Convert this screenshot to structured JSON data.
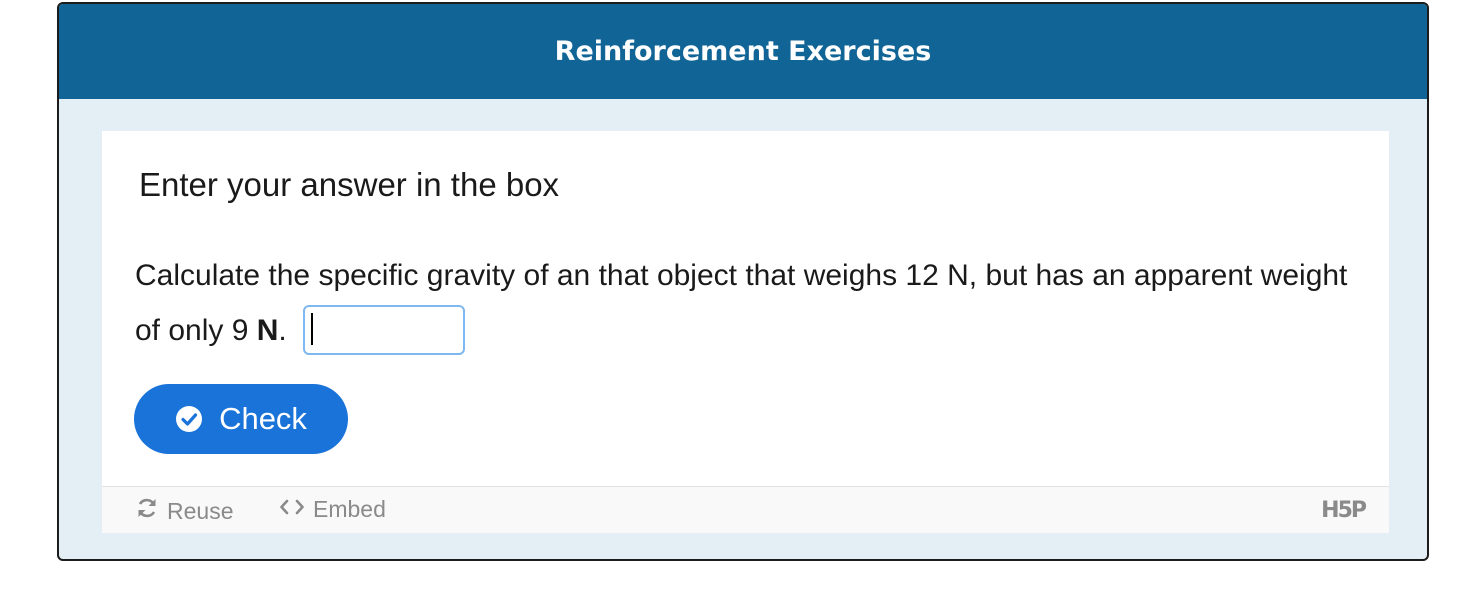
{
  "header": {
    "title": "Reinforcement Exercises",
    "color": "#116496"
  },
  "card": {
    "instruction": "Enter your answer in the box",
    "question_text": "Calculate the specific gravity of an that object that weighs 12 N, but has an apparent weight of only 9 ",
    "question_unit": "N",
    "question_end": ".",
    "answer_value": "",
    "check_label": "Check",
    "check_icon": "check-circle-icon",
    "check_color": "#1a73d9"
  },
  "footer": {
    "reuse_label": "Reuse",
    "reuse_icon": "refresh-icon",
    "embed_label": "Embed",
    "embed_icon": "code-icon",
    "logo_text": "H5P"
  }
}
